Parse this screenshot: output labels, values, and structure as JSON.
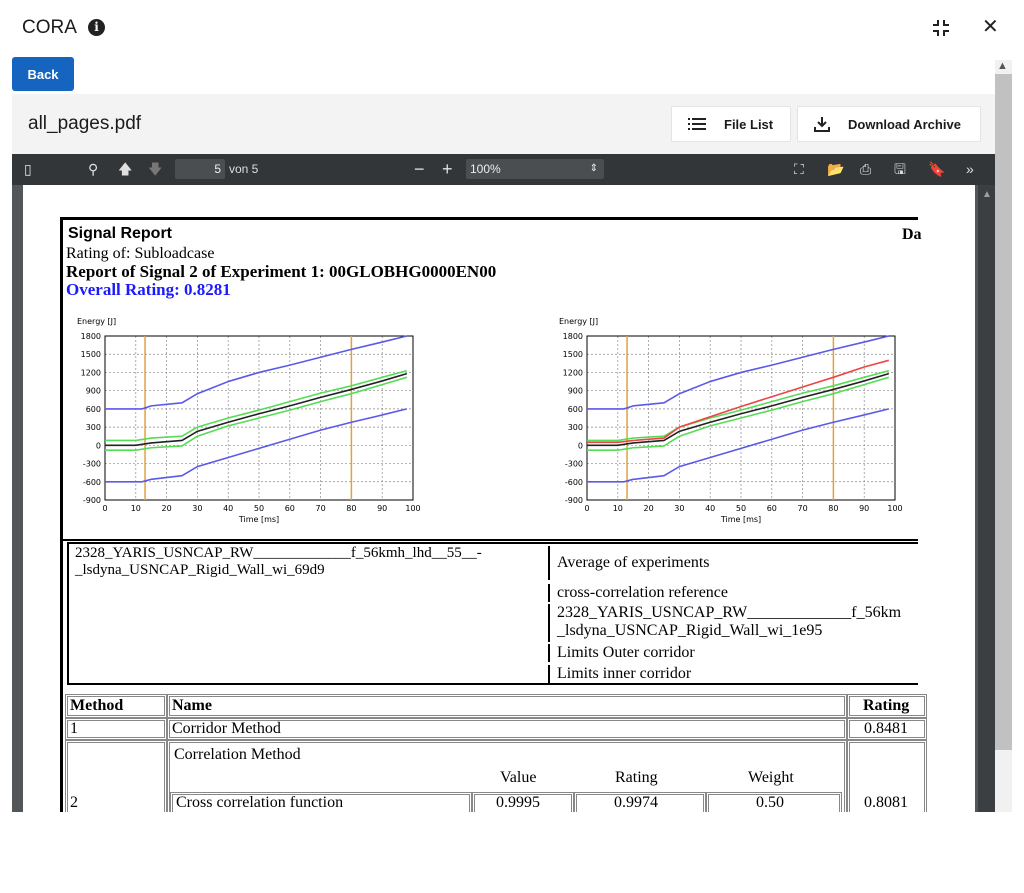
{
  "app": {
    "title": "CORA",
    "info_icon": "info-icon",
    "collapse_icon": "collapse-icon",
    "close_icon": "close-icon"
  },
  "back_label": "Back",
  "file": {
    "name": "all_pages.pdf",
    "file_list_label": "File List",
    "download_label": "Download Archive"
  },
  "pdf_toolbar": {
    "page": "5",
    "page_total": "von 5",
    "zoom": "100%"
  },
  "report": {
    "title": "Signal Report",
    "rating_of": "Rating of: Subloadcase",
    "signal_line": "Report of Signal 2 of Experiment 1: 00GLOBHG0000EN00",
    "overall_rating": "Overall Rating: 0.8281",
    "date_fragment": "Da"
  },
  "legend": {
    "left_entry_line1": "2328_YARIS_USNCAP_RW_____________f_56kmh_lhd__55__-",
    "left_entry_line2": "_lsdyna_USNCAP_Rigid_Wall_wi_69d9",
    "items": [
      "Average of experiments",
      "cross-correlation reference",
      "2328_YARIS_USNCAP_RW_____________f_56km",
      "_lsdyna_USNCAP_Rigid_Wall_wi_1e95",
      "Limits Outer corridor",
      "Limits inner corridor"
    ]
  },
  "table": {
    "headers": {
      "method": "Method",
      "name": "Name",
      "rating": "Rating"
    },
    "rows": [
      {
        "method": "1",
        "name": "Corridor Method",
        "rating": "0.8481"
      },
      {
        "method": "2",
        "name": "Correlation Method",
        "rating": "0.8081"
      }
    ],
    "sub_headers": {
      "value": "Value",
      "rating": "Rating",
      "weight": "Weight"
    },
    "sub_row": {
      "name": "Cross correlation function",
      "value": "0.9995",
      "rating": "0.9974",
      "weight": "0.50"
    }
  },
  "chart_data": [
    {
      "type": "line",
      "ylabel": "Energy [J]",
      "xlabel": "Time [ms]",
      "xlim": [
        0,
        100
      ],
      "ylim": [
        -900,
        1800
      ],
      "xticks": [
        0,
        10,
        20,
        30,
        40,
        50,
        60,
        70,
        80,
        90,
        100
      ],
      "yticks": [
        1800,
        1500,
        1200,
        900,
        600,
        300,
        0,
        -300,
        -600,
        -900
      ],
      "grid": true,
      "series": [
        {
          "color": "#5a5ae8",
          "x": [
            0,
            12,
            15,
            25,
            30,
            40,
            50,
            60,
            70,
            80,
            90,
            98
          ],
          "y": [
            600,
            600,
            650,
            700,
            850,
            1050,
            1200,
            1320,
            1450,
            1580,
            1700,
            1800
          ]
        },
        {
          "color": "#5a5ae8",
          "x": [
            0,
            12,
            15,
            25,
            30,
            40,
            50,
            60,
            70,
            80,
            90,
            98
          ],
          "y": [
            -600,
            -600,
            -560,
            -500,
            -350,
            -200,
            -50,
            100,
            250,
            380,
            500,
            600
          ]
        },
        {
          "color": "#55dd55",
          "x": [
            0,
            10,
            15,
            25,
            30,
            40,
            50,
            60,
            70,
            80,
            90,
            98
          ],
          "y": [
            80,
            80,
            120,
            150,
            300,
            450,
            580,
            720,
            860,
            980,
            1120,
            1230
          ]
        },
        {
          "color": "#55dd55",
          "x": [
            0,
            10,
            15,
            25,
            30,
            40,
            50,
            60,
            70,
            80,
            90,
            98
          ],
          "y": [
            -80,
            -80,
            -40,
            -10,
            150,
            320,
            450,
            580,
            720,
            850,
            1000,
            1120
          ]
        },
        {
          "color": "#222222",
          "x": [
            0,
            10,
            15,
            25,
            30,
            40,
            50,
            60,
            70,
            80,
            90,
            98
          ],
          "y": [
            0,
            0,
            40,
            80,
            230,
            380,
            520,
            650,
            790,
            920,
            1060,
            1180
          ]
        }
      ],
      "vlines": [
        13,
        80
      ]
    },
    {
      "type": "line",
      "ylabel": "Energy [J]",
      "xlabel": "Time [ms]",
      "xlim": [
        0,
        100
      ],
      "ylim": [
        -900,
        1800
      ],
      "xticks": [
        0,
        10,
        20,
        30,
        40,
        50,
        60,
        70,
        80,
        90,
        100
      ],
      "yticks": [
        1800,
        1500,
        1200,
        900,
        600,
        300,
        0,
        -300,
        -600,
        -900
      ],
      "grid": true,
      "series": [
        {
          "color": "#5a5ae8",
          "x": [
            0,
            12,
            15,
            25,
            30,
            40,
            50,
            60,
            70,
            80,
            90,
            98
          ],
          "y": [
            600,
            600,
            650,
            700,
            850,
            1050,
            1200,
            1320,
            1450,
            1580,
            1700,
            1800
          ]
        },
        {
          "color": "#5a5ae8",
          "x": [
            0,
            12,
            15,
            25,
            30,
            40,
            50,
            60,
            70,
            80,
            90,
            98
          ],
          "y": [
            -600,
            -600,
            -560,
            -500,
            -350,
            -200,
            -50,
            100,
            250,
            380,
            500,
            600
          ]
        },
        {
          "color": "#55dd55",
          "x": [
            0,
            10,
            15,
            25,
            30,
            40,
            50,
            60,
            70,
            80,
            90,
            98
          ],
          "y": [
            80,
            80,
            120,
            150,
            300,
            450,
            580,
            720,
            860,
            980,
            1120,
            1230
          ]
        },
        {
          "color": "#55dd55",
          "x": [
            0,
            10,
            15,
            25,
            30,
            40,
            50,
            60,
            70,
            80,
            90,
            98
          ],
          "y": [
            -80,
            -80,
            -40,
            -10,
            150,
            320,
            450,
            580,
            720,
            850,
            1000,
            1120
          ]
        },
        {
          "color": "#222222",
          "x": [
            0,
            10,
            15,
            25,
            30,
            40,
            50,
            60,
            70,
            80,
            90,
            98
          ],
          "y": [
            0,
            0,
            40,
            80,
            230,
            380,
            520,
            650,
            790,
            920,
            1060,
            1180
          ]
        },
        {
          "color": "#ee4444",
          "x": [
            0,
            10,
            15,
            25,
            30,
            40,
            50,
            60,
            70,
            80,
            90,
            98
          ],
          "y": [
            50,
            50,
            80,
            120,
            300,
            470,
            640,
            800,
            960,
            1120,
            1290,
            1400
          ]
        }
      ],
      "vlines": [
        13,
        80
      ]
    }
  ]
}
